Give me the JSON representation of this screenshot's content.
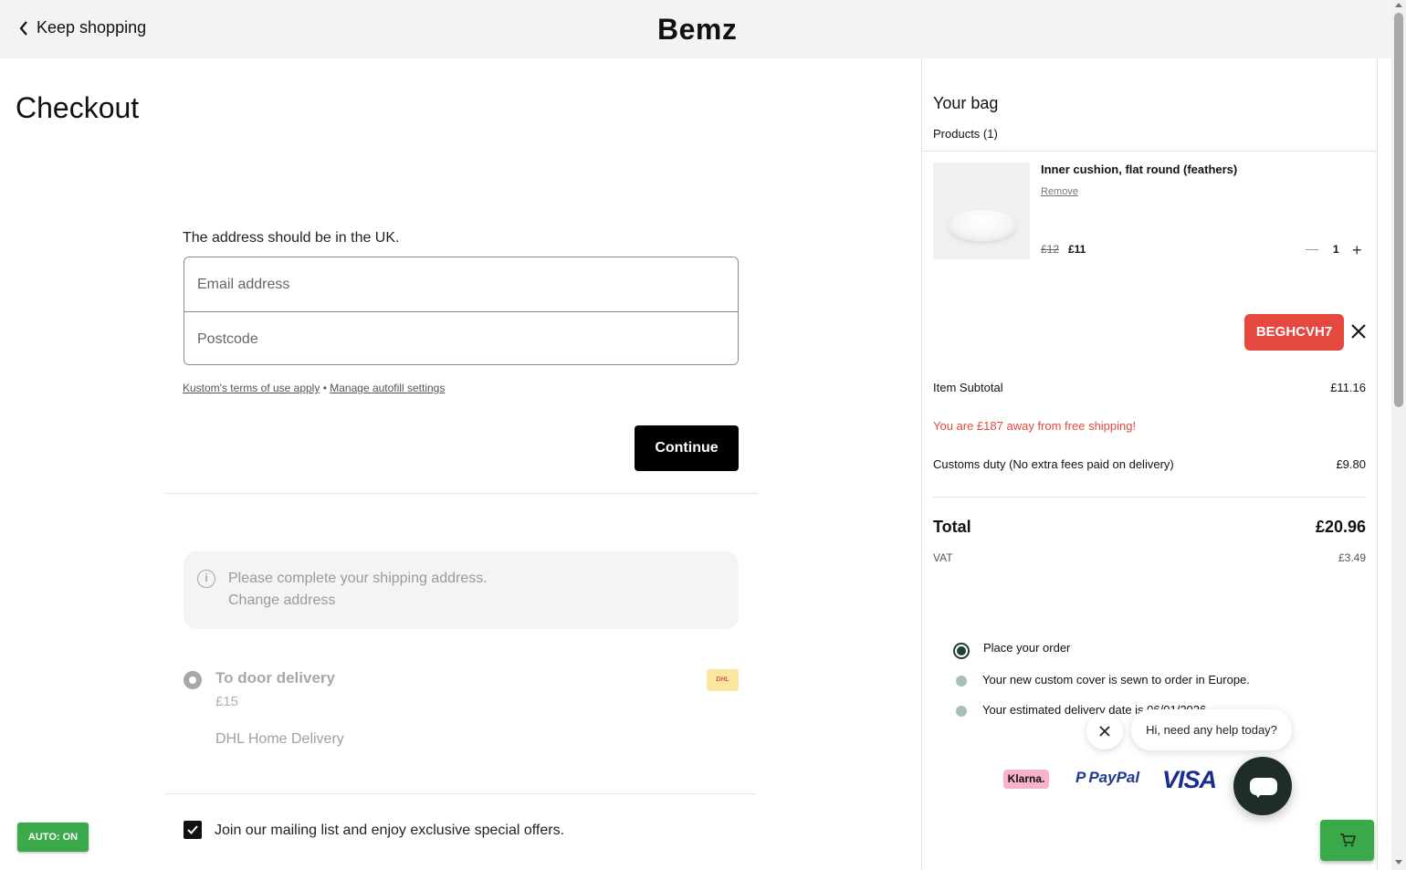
{
  "header": {
    "back_label": "Keep shopping",
    "brand": "Bemz"
  },
  "checkout": {
    "title": "Checkout",
    "address_note": "The address should be in the UK.",
    "email_placeholder": "Email address",
    "postcode_placeholder": "Postcode",
    "terms_link": "Kustom's terms of use apply",
    "terms_separator": "•",
    "autofill_link": "Manage autofill settings",
    "continue_label": "Continue",
    "notice": {
      "icon": "info-icon",
      "line1": "Please complete your shipping address.",
      "line2": "Change address"
    },
    "shipping": {
      "name": "To door delivery",
      "price": "£15",
      "method": "DHL Home Delivery",
      "carrier_logo": "DHL"
    },
    "mailing_list": {
      "checked": true,
      "label": "Join our mailing list and enjoy exclusive special offers."
    },
    "auto_badge": "AUTO: ON"
  },
  "bag": {
    "title": "Your bag",
    "products_label": "Products (1)",
    "item": {
      "name": "Inner cushion, flat round (feathers)",
      "remove_label": "Remove",
      "old_price": "£12",
      "new_price": "£11",
      "quantity": "1",
      "minus": "—",
      "plus": "+"
    },
    "coupon_code": "BEGHCVH7",
    "subtotal_label": "Item Subtotal",
    "subtotal_value": "£11.16",
    "free_shipping_message": "You are £187 away from free shipping!",
    "customs_label": "Customs duty (No extra fees paid on delivery)",
    "customs_value": "£9.80",
    "total_label": "Total",
    "total_value": "£20.96",
    "vat_label": "VAT",
    "vat_value": "£3.49",
    "steps": [
      {
        "label": "Place your order"
      },
      {
        "label": "Your new custom cover is sewn to order in Europe."
      },
      {
        "label": "Your estimated delivery date is 06/01/2026"
      }
    ],
    "payment_methods": [
      "Klarna.",
      "PayPal",
      "VISA"
    ]
  },
  "chat": {
    "greeting": "Hi, need any help today?"
  },
  "colors": {
    "accent_red": "#e5483e",
    "green": "#3aa94a",
    "dark": "#000000",
    "chat_dark": "#1e2d29"
  }
}
